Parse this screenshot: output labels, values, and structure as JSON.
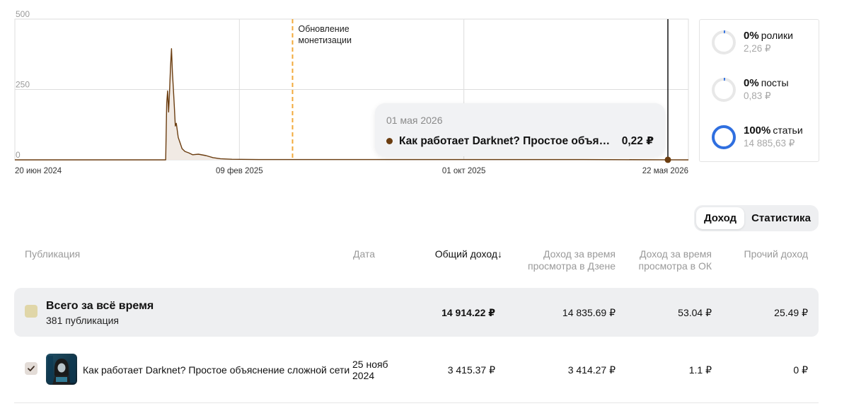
{
  "chart_data": {
    "type": "area",
    "y_ticks": [
      "500",
      "250",
      "0"
    ],
    "ylim": [
      0,
      500
    ],
    "x_labels": [
      "20 июн 2024",
      "09 фев 2025",
      "01 окт 2025",
      "22 мая 2026"
    ],
    "xlim": [
      "2024-06-20",
      "2026-05-22"
    ],
    "grid": true,
    "series": [
      {
        "color": "#6b3d10",
        "points": [
          [
            "2024-06-20",
            0
          ],
          [
            "2024-11-20",
            0
          ],
          [
            "2024-11-24",
            0
          ],
          [
            "2024-11-25",
            200
          ],
          [
            "2024-11-26",
            245
          ],
          [
            "2024-11-27",
            170
          ],
          [
            "2024-11-28",
            240
          ],
          [
            "2024-11-29",
            330
          ],
          [
            "2024-11-30",
            395
          ],
          [
            "2024-12-01",
            310
          ],
          [
            "2024-12-02",
            250
          ],
          [
            "2024-12-03",
            190
          ],
          [
            "2024-12-04",
            120
          ],
          [
            "2024-12-05",
            130
          ],
          [
            "2024-12-07",
            80
          ],
          [
            "2024-12-09",
            60
          ],
          [
            "2024-12-11",
            40
          ],
          [
            "2024-12-14",
            30
          ],
          [
            "2024-12-18",
            25
          ],
          [
            "2024-12-22",
            18
          ],
          [
            "2024-12-28",
            20
          ],
          [
            "2025-01-05",
            15
          ],
          [
            "2025-01-12",
            8
          ],
          [
            "2025-01-20",
            4
          ],
          [
            "2025-02-01",
            2
          ],
          [
            "2025-03-01",
            1
          ],
          [
            "2025-06-01",
            1
          ],
          [
            "2025-10-01",
            1
          ],
          [
            "2026-02-01",
            1
          ],
          [
            "2026-05-01",
            0.22
          ],
          [
            "2026-05-22",
            0
          ]
        ]
      }
    ],
    "annotations": [
      {
        "date": "2025-04-05",
        "text": [
          "Обновление",
          "монетизации"
        ],
        "color": "#f2a93b"
      }
    ],
    "cursor": {
      "date": "2026-05-01",
      "value": 0.22
    }
  },
  "tooltip": {
    "date": "01 мая 2026",
    "title": "Как работает Darknet? Простое объясне...",
    "value": "0,22 ₽"
  },
  "breakdown": [
    {
      "percent": "0%",
      "label": "ролики",
      "amount": "2,26 ₽",
      "fraction": 0.02
    },
    {
      "percent": "0%",
      "label": "посты",
      "amount": "0,83 ₽",
      "fraction": 0.02
    },
    {
      "percent": "100%",
      "label": "статьи",
      "amount": "14 885,63 ₽",
      "fraction": 1.0
    }
  ],
  "ring_colors": {
    "track": "#e8e8e8",
    "fill": "#2f6fe0"
  },
  "toggle": {
    "active": "Доход",
    "inactive": "Статистика"
  },
  "table": {
    "headers": {
      "publication": "Публикация",
      "date": "Дата",
      "total": "Общий доход",
      "sort_arrow": "↓",
      "dzen_1": "Доход за время",
      "dzen_2": "просмотра в Дзене",
      "ok_1": "Доход за время",
      "ok_2": "просмотра в ОК",
      "other": "Прочий доход"
    },
    "total_row": {
      "title": "Всего за всё время",
      "subtitle": "381 публикация",
      "total": "14 914.22 ₽",
      "dzen": "14 835.69 ₽",
      "ok": "53.04 ₽",
      "other": "25.49 ₽"
    },
    "rows": [
      {
        "title": "Как работает Darknet? Простое объяснение сложной сети",
        "date_1": "25 нояб",
        "date_2": "2024",
        "total": "3 415.37 ₽",
        "dzen": "3 414.27 ₽",
        "ok": "1.1 ₽",
        "other": "0 ₽",
        "checked": true
      }
    ]
  }
}
